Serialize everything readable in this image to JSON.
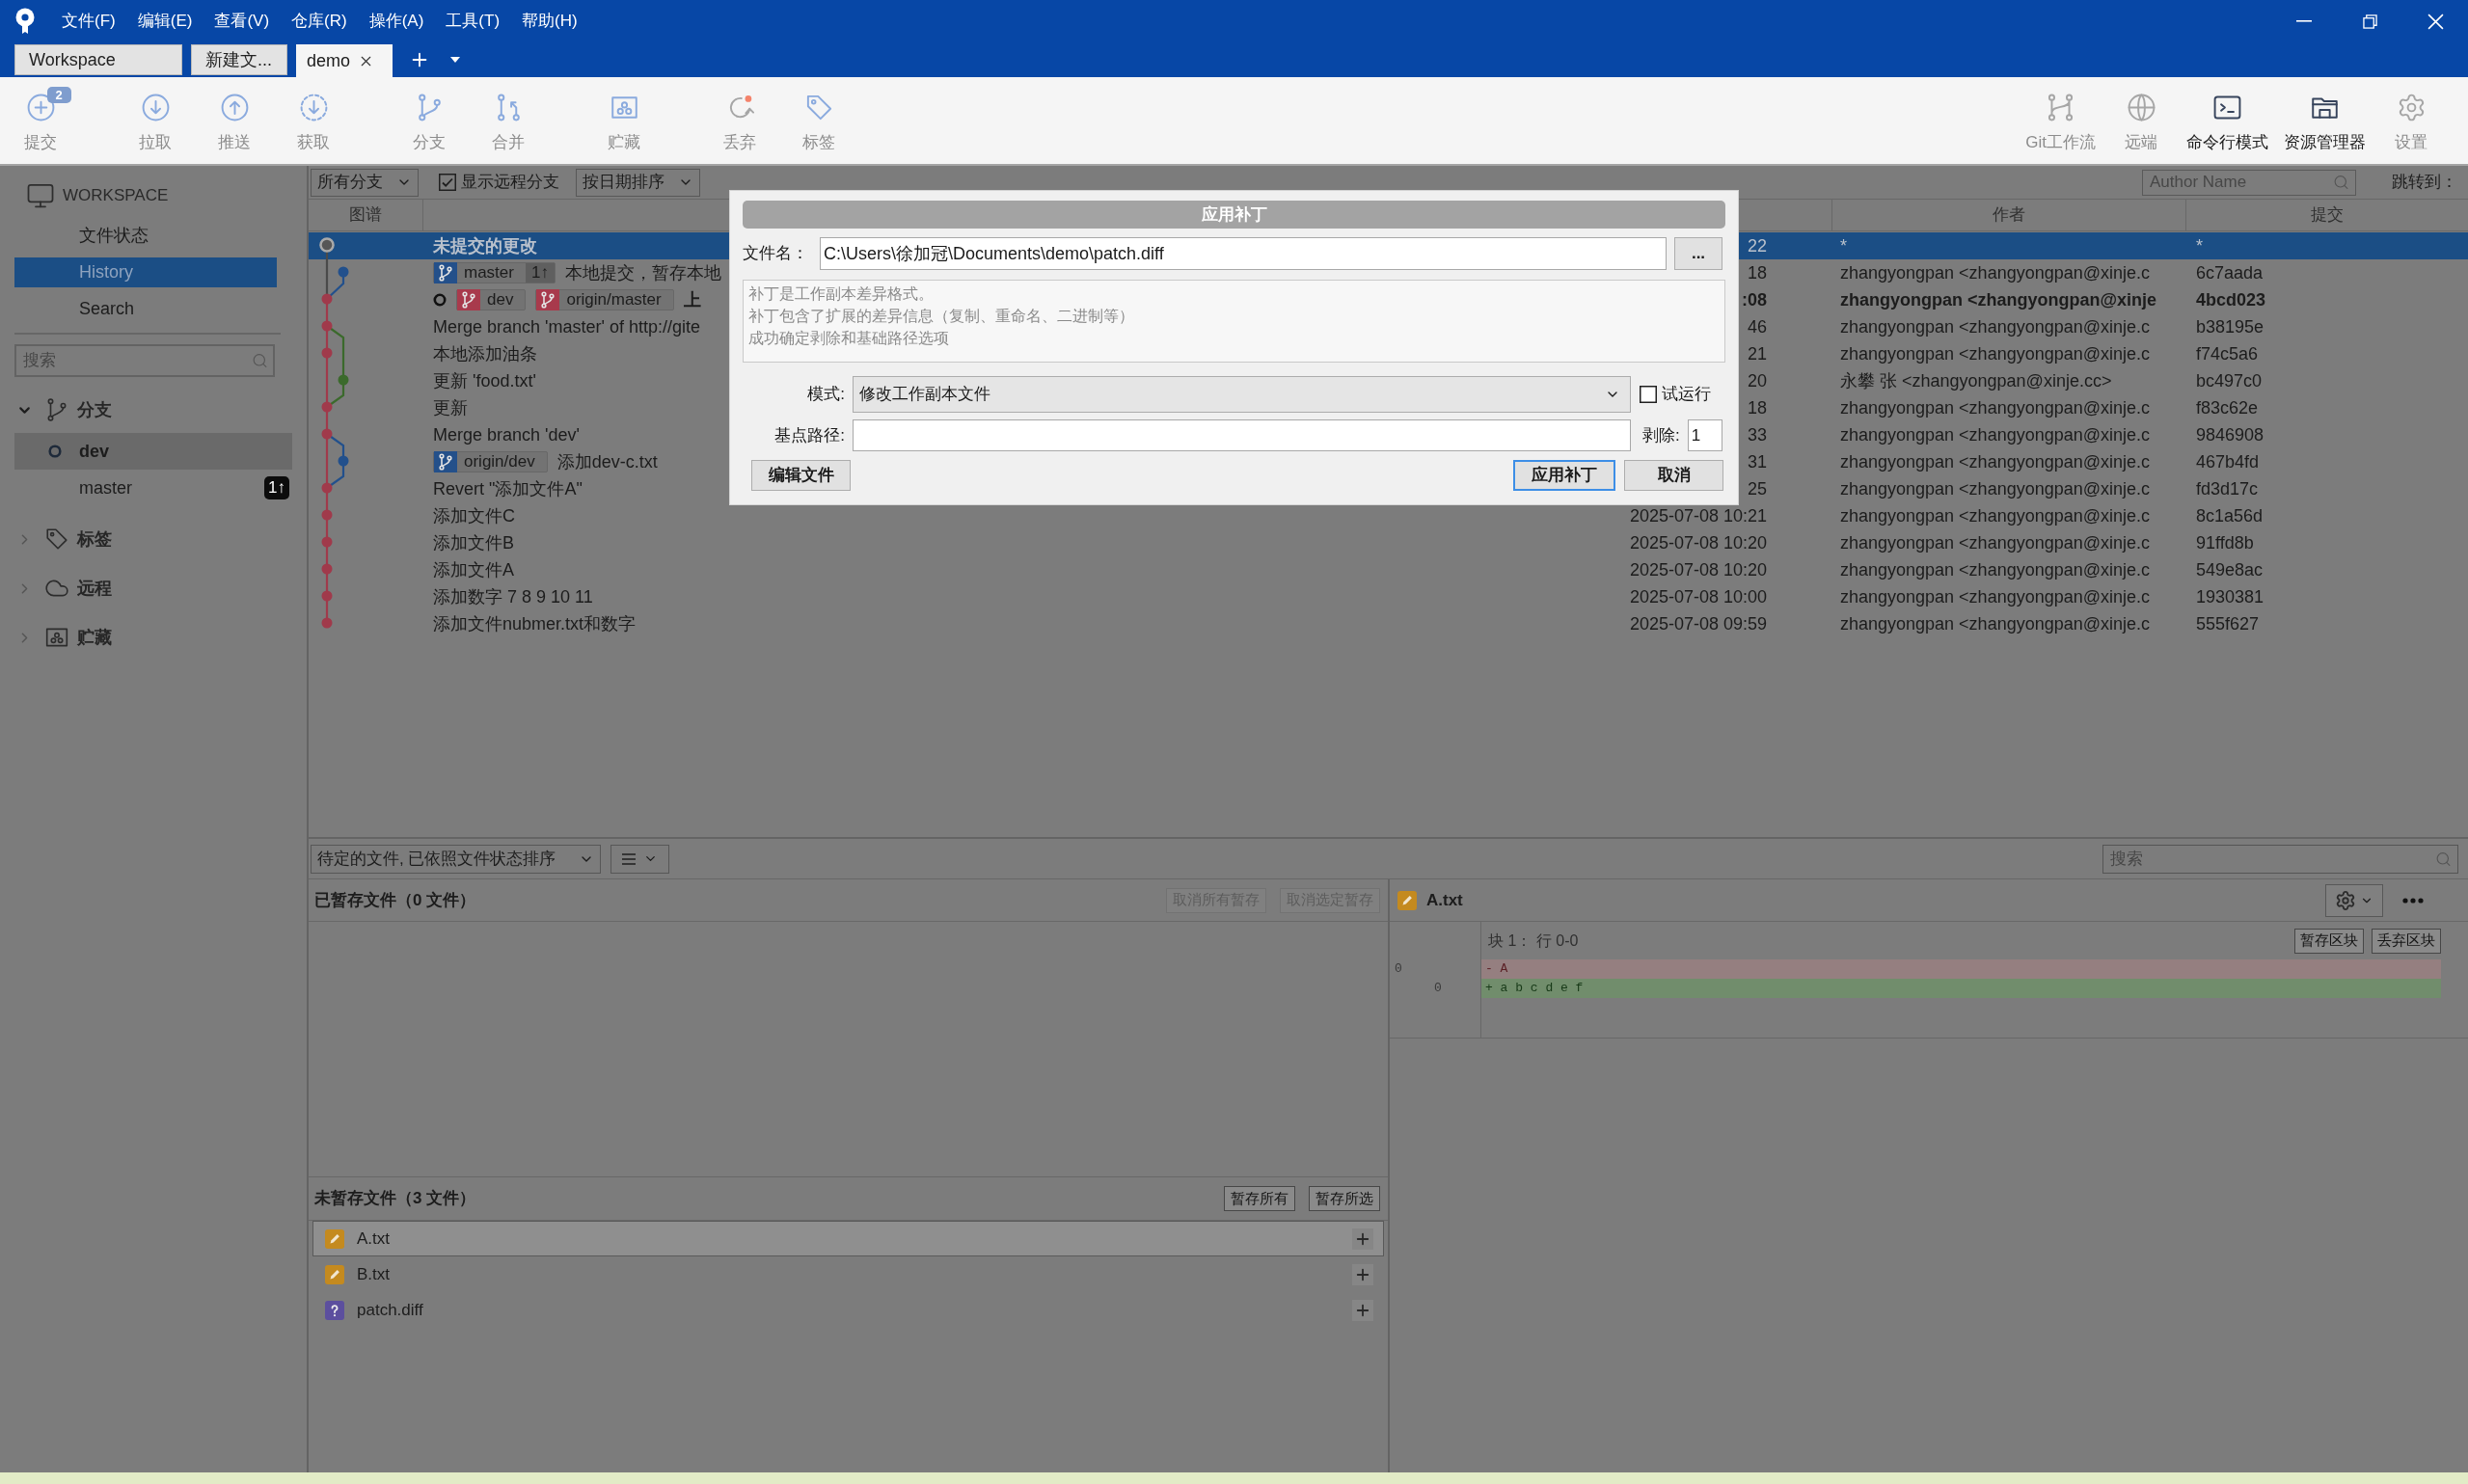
{
  "menu_bar": {
    "items": [
      "文件(F)",
      "编辑(E)",
      "查看(V)",
      "仓库(R)",
      "操作(A)",
      "工具(T)",
      "帮助(H)"
    ]
  },
  "tabs": [
    {
      "label": "Workspace",
      "selected": false
    },
    {
      "label": "新建文...",
      "selected": false
    },
    {
      "label": "demo",
      "selected": true
    }
  ],
  "toolbar": {
    "left": [
      {
        "kind": "commit",
        "label": "提交",
        "disabled": true,
        "badge": "2"
      },
      {
        "kind": "pull",
        "label": "拉取",
        "disabled": true
      },
      {
        "kind": "push",
        "label": "推送",
        "disabled": true
      },
      {
        "kind": "fetch",
        "label": "获取",
        "disabled": true
      },
      {
        "kind": "branch",
        "label": "分支",
        "disabled": true
      },
      {
        "kind": "merge",
        "label": "合并",
        "disabled": true
      },
      {
        "kind": "stash",
        "label": "贮藏",
        "disabled": true
      },
      {
        "kind": "discard",
        "label": "丢弃",
        "disabled": true
      },
      {
        "kind": "tag",
        "label": "标签",
        "disabled": true
      }
    ],
    "right": [
      {
        "kind": "gitflow",
        "label": "Git工作流",
        "disabled": true
      },
      {
        "kind": "remote",
        "label": "远端",
        "disabled": true
      },
      {
        "kind": "terminal",
        "label": "命令行模式",
        "disabled": false
      },
      {
        "kind": "explorer",
        "label": "资源管理器",
        "disabled": false
      },
      {
        "kind": "settings",
        "label": "设置",
        "disabled": true
      }
    ]
  },
  "sidebar": {
    "workspace": {
      "title": "WORKSPACE",
      "items": [
        {
          "label": "文件状态",
          "selected": false
        },
        {
          "label": "History",
          "selected": true
        },
        {
          "label": "Search",
          "selected": false
        }
      ]
    },
    "search": {
      "placeholder": "搜索"
    },
    "sections": [
      {
        "kind": "branch",
        "title": "分支",
        "expanded": true,
        "children": [
          {
            "label": "dev",
            "selected": true,
            "current": true
          },
          {
            "label": "master",
            "selected": false,
            "current": false,
            "badge": "1↑"
          }
        ]
      },
      {
        "kind": "tag",
        "title": "标签",
        "expanded": false
      },
      {
        "kind": "remote",
        "title": "远程",
        "expanded": false
      },
      {
        "kind": "stash",
        "title": "贮藏",
        "expanded": false
      }
    ]
  },
  "history": {
    "filters": {
      "branch_filter": "所有分支",
      "show_remote": {
        "label": "显示远程分支",
        "checked": true
      },
      "sort": "按日期排序",
      "author_search": {
        "placeholder": "Author Name"
      },
      "jump_label": "跳转到："
    },
    "columns": {
      "graph": "图谱",
      "author": "作者",
      "commit": "提交"
    },
    "rows": [
      {
        "kind": "uncommitted",
        "selected": true,
        "head": false,
        "description": "未提交的更改",
        "date": "22",
        "author": "*",
        "commit": "*"
      },
      {
        "kind": "commit",
        "selected": false,
        "head": false,
        "refs": [
          {
            "name": "master",
            "color": "#24508a",
            "ahead": "1↑"
          }
        ],
        "description": "本地提交，暂存本地",
        "date": "18",
        "author": "zhangyongpan <zhangyongpan@xinje.c",
        "commit": "6c7aada"
      },
      {
        "kind": "commit",
        "selected": false,
        "head": true,
        "refs": [
          {
            "name": "dev",
            "color": "#a83a4c"
          },
          {
            "name": "origin/master",
            "color": "#a83a4c"
          }
        ],
        "description": "上",
        "date": ":08",
        "author": "zhangyongpan <zhangyongpan@xinje",
        "commit": "4bcd023"
      },
      {
        "kind": "commit",
        "selected": false,
        "head": false,
        "description": "Merge branch 'master' of http://gite",
        "date": "46",
        "author": "zhangyongpan <zhangyongpan@xinje.c",
        "commit": "b38195e"
      },
      {
        "kind": "commit",
        "selected": false,
        "head": false,
        "description": "本地添加油条",
        "date": "21",
        "author": "zhangyongpan <zhangyongpan@xinje.c",
        "commit": "f74c5a6"
      },
      {
        "kind": "commit",
        "selected": false,
        "head": false,
        "description": "更新 'food.txt'",
        "date": "20",
        "author": "永攀 张 <zhangyongpan@xinje.cc>",
        "commit": "bc497c0"
      },
      {
        "kind": "commit",
        "selected": false,
        "head": false,
        "description": "更新",
        "date": "18",
        "author": "zhangyongpan <zhangyongpan@xinje.c",
        "commit": "f83c62e"
      },
      {
        "kind": "commit",
        "selected": false,
        "head": false,
        "description": "Merge branch 'dev'",
        "date": "33",
        "author": "zhangyongpan <zhangyongpan@xinje.c",
        "commit": "9846908"
      },
      {
        "kind": "commit",
        "selected": false,
        "head": false,
        "refs": [
          {
            "name": "origin/dev",
            "color": "#24508a"
          }
        ],
        "description": "添加dev-c.txt",
        "date": "31",
        "author": "zhangyongpan <zhangyongpan@xinje.c",
        "commit": "467b4fd"
      },
      {
        "kind": "commit",
        "selected": false,
        "head": false,
        "description": "Revert \"添加文件A\"",
        "date": "25",
        "author": "zhangyongpan <zhangyongpan@xinje.c",
        "commit": "fd3d17c"
      },
      {
        "kind": "commit",
        "selected": false,
        "head": false,
        "description": "添加文件C",
        "date": "2025-07-08 10:21",
        "author": "zhangyongpan <zhangyongpan@xinje.c",
        "commit": "8c1a56d"
      },
      {
        "kind": "commit",
        "selected": false,
        "head": false,
        "description": "添加文件B",
        "date": "2025-07-08 10:20",
        "author": "zhangyongpan <zhangyongpan@xinje.c",
        "commit": "91ffd8b"
      },
      {
        "kind": "commit",
        "selected": false,
        "head": false,
        "description": "添加文件A",
        "date": "2025-07-08 10:20",
        "author": "zhangyongpan <zhangyongpan@xinje.c",
        "commit": "549e8ac"
      },
      {
        "kind": "commit",
        "selected": false,
        "head": false,
        "description": "添加数字 7 8 9 10 11",
        "date": "2025-07-08 10:00",
        "author": "zhangyongpan <zhangyongpan@xinje.c",
        "commit": "1930381"
      },
      {
        "kind": "commit",
        "selected": false,
        "head": false,
        "description": "添加文件nubmer.txt和数字",
        "date": "2025-07-08 09:59",
        "author": "zhangyongpan <zhangyongpan@xinje.c",
        "commit": "555f627"
      }
    ]
  },
  "dialog": {
    "title": "应用补丁",
    "filename": {
      "label": "文件名：",
      "value": "C:\\Users\\徐加冠\\Documents\\demo\\patch.diff"
    },
    "browse": "...",
    "info": [
      "补丁是工作副本差异格式。",
      "补丁包含了扩展的差异信息（复制、重命名、二进制等）",
      "成功确定剥除和基础路径选项"
    ],
    "mode": {
      "label": "模式:",
      "value": "修改工作副本文件"
    },
    "dry_run": {
      "label": "试运行",
      "checked": false
    },
    "base_path": {
      "label": "基点路径:"
    },
    "strip": {
      "label": "剥除:",
      "value": "1"
    },
    "buttons": [
      {
        "label": "编辑文件",
        "kind": "secondary"
      },
      {
        "label": "应用补丁",
        "kind": "default"
      },
      {
        "label": "取消",
        "kind": "secondary"
      }
    ]
  },
  "changes": {
    "sort_dropdown": "待定的文件, 已依照文件状态排序",
    "search": {
      "placeholder": "搜索"
    },
    "staged": {
      "title": "已暂存文件（0 文件）",
      "buttons": [
        {
          "label": "取消所有暂存",
          "disabled": true
        },
        {
          "label": "取消选定暂存",
          "disabled": true
        }
      ]
    },
    "unstaged": {
      "title": "未暂存文件（3 文件）",
      "buttons": [
        {
          "label": "暂存所有",
          "disabled": false
        },
        {
          "label": "暂存所选",
          "disabled": false
        }
      ],
      "files": [
        {
          "name": "A.txt",
          "kind": "modified",
          "selected": true
        },
        {
          "name": "B.txt",
          "kind": "modified",
          "selected": false
        },
        {
          "name": "patch.diff",
          "kind": "untracked",
          "selected": false
        }
      ]
    }
  },
  "diff": {
    "file": {
      "name": "A.txt",
      "kind": "modified"
    },
    "hunk": {
      "title": "块 1： 行 0-0",
      "buttons": [
        "暂存区块",
        "丢弃区块"
      ]
    },
    "lines": [
      {
        "kind": "removed",
        "old": "0",
        "text": "- A"
      },
      {
        "kind": "added",
        "new": "0",
        "text": "+ a b c d e f"
      }
    ]
  }
}
